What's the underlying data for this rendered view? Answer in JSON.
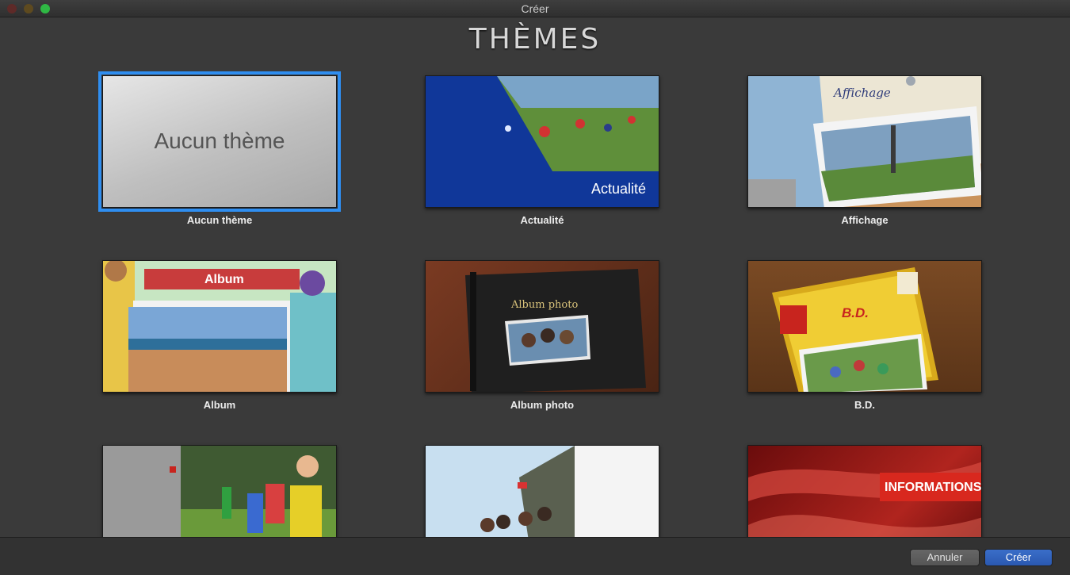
{
  "window": {
    "title": "Créer"
  },
  "heading": "THÈMES",
  "themes": [
    {
      "label": "Aucun thème",
      "thumb_text": "Aucun thème"
    },
    {
      "label": "Actualité",
      "thumb_text": "Actualité"
    },
    {
      "label": "Affichage",
      "thumb_text": "Affichage"
    },
    {
      "label": "Album",
      "thumb_text": "Album"
    },
    {
      "label": "Album photo",
      "thumb_text": "Album photo"
    },
    {
      "label": "B.D.",
      "thumb_text": "B.D."
    },
    {
      "label": "",
      "thumb_text": ""
    },
    {
      "label": "",
      "thumb_text": ""
    },
    {
      "label": "",
      "thumb_text": "INFORMATIONS"
    }
  ],
  "buttons": {
    "cancel": "Annuler",
    "create": "Créer"
  },
  "colors": {
    "selection": "#2f8ef0",
    "create_button": "#2a58b0"
  }
}
